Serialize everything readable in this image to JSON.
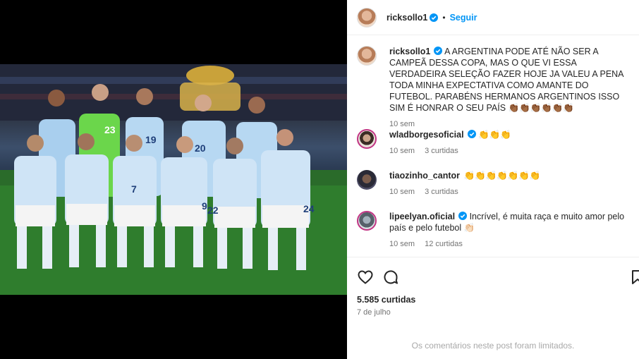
{
  "post": {
    "author": "ricksollo1",
    "follow_label": "Seguir",
    "dot": "•",
    "likes": "5.585 curtidas",
    "date": "7 de julho",
    "comments_limited": "Os comentários neste post foram limitados."
  },
  "caption": {
    "username": "ricksollo1",
    "text": "A ARGENTINA PODE ATÉ NÃO SER A CAMPEÃ DESSA COPA, MAS O QUE VI ESSA VERDADEIRA SELEÇÃO FAZER HOJE JA VALEU A PENA TODA MINHA EXPECTATIVA COMO AMANTE DO FUTEBOL. PARABÉNS HERMANOS ARGENTINOS ISSO SIM É HONRAR O SEU PAÍS 👏🏾👏🏾👏🏾👏🏾👏🏾👏🏾",
    "time": "10 sem"
  },
  "comments": [
    {
      "username": "wladborgesoficial",
      "text": "👏👏👏",
      "time": "10 sem",
      "likes": "3 curtidas"
    },
    {
      "username": "tiaozinho_cantor",
      "text": "👏👏👏👏👏👏👏",
      "time": "10 sem",
      "likes": "3 curtidas"
    },
    {
      "username": "lipeelyan.oficial",
      "text": "Incrível, é muita raça e muito amor pelo país e pelo futebol 👏🏻",
      "time": "10 sem",
      "likes": "12 curtidas"
    }
  ],
  "photo": {
    "jersey_numbers": [
      "23",
      "19",
      "20",
      "7",
      "22",
      "24",
      "9"
    ]
  },
  "colors": {
    "accent": "#0095f6",
    "muted": "#737373",
    "border": "#efefef"
  },
  "icons": [
    "heart-icon",
    "comment-icon",
    "save-icon",
    "verified-icon"
  ]
}
